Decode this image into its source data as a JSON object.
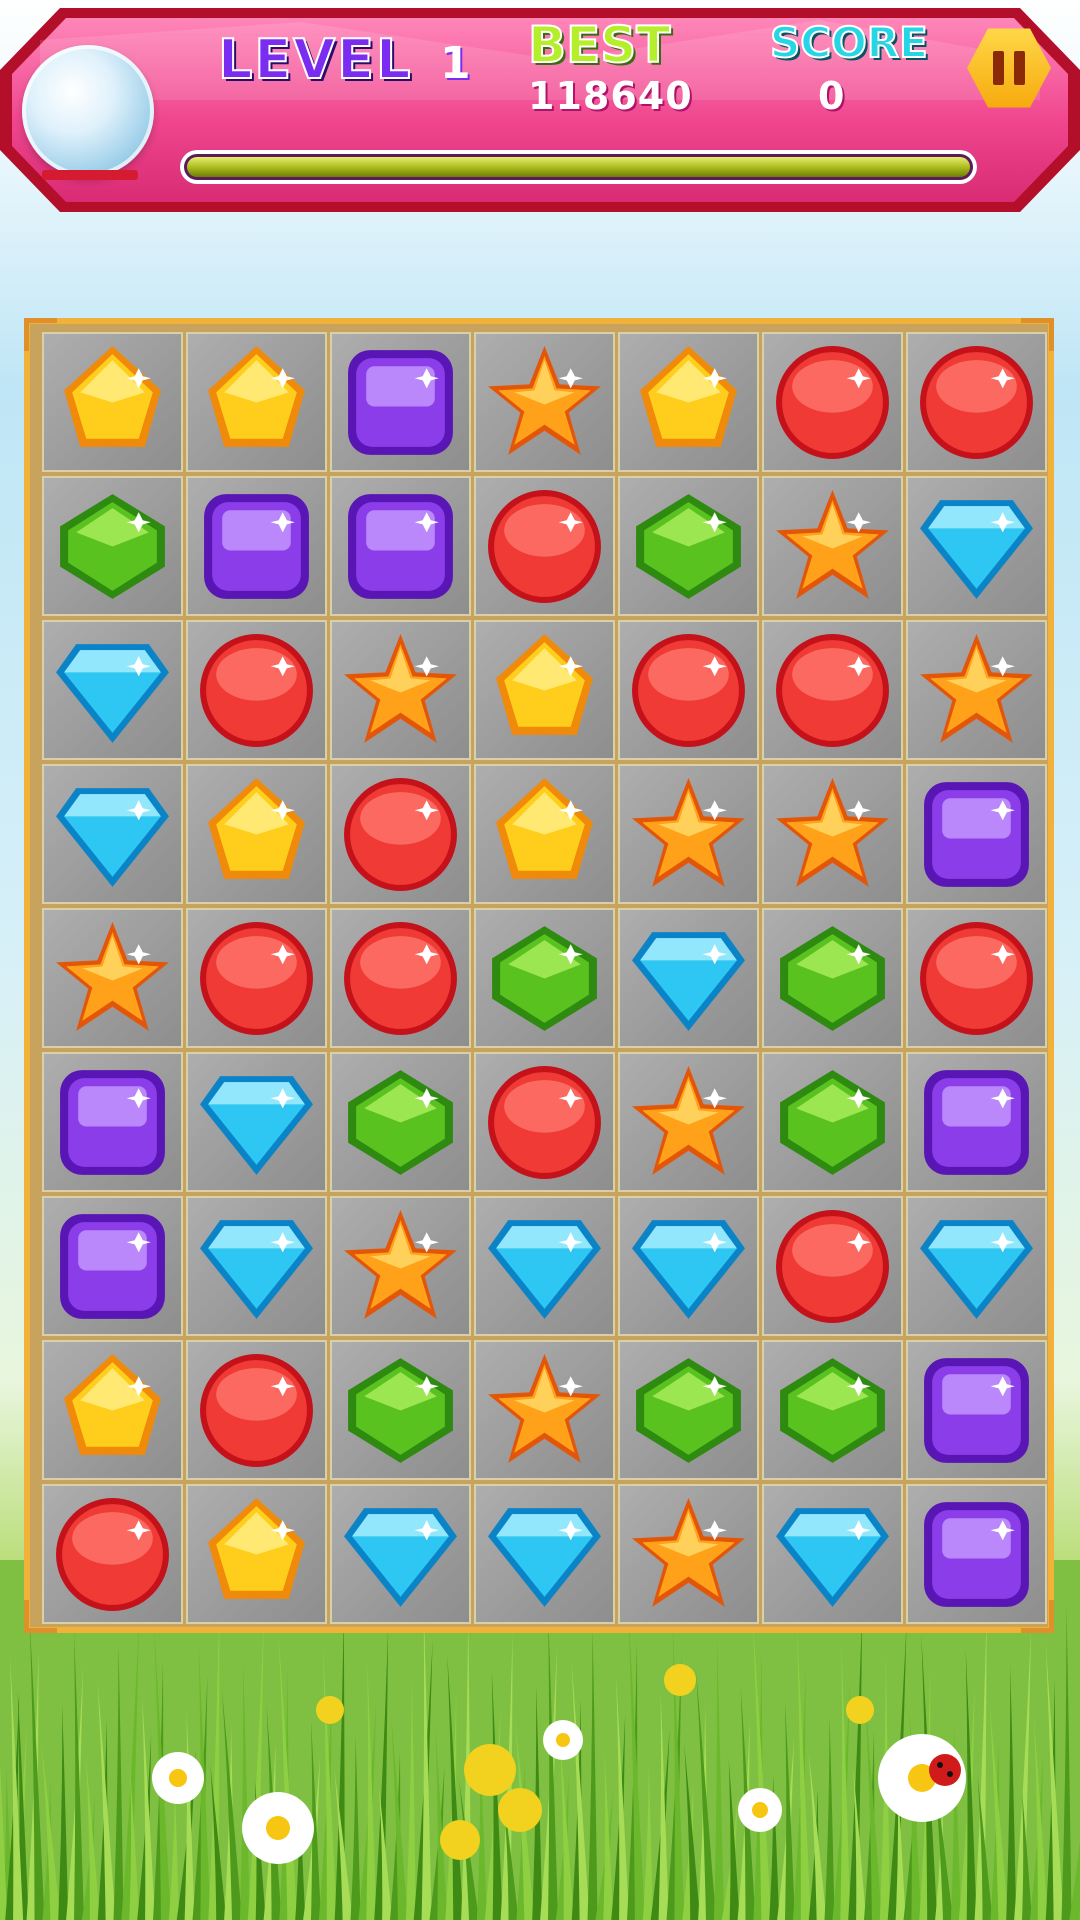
{
  "header": {
    "level_label": "LEVEL",
    "level_value": "1",
    "best_label": "BEST",
    "best_value": "118640",
    "score_label": "SCORE",
    "score_value": "0",
    "progress_fraction": 1.0,
    "pause_icon": "pause-icon",
    "orb_icon": "snow-globe-icon"
  },
  "colors": {
    "header_pink": "#f0478f",
    "header_border": "#c4102e",
    "board_border": "#f2b23a",
    "tile_gray": "#9f9f9f"
  },
  "board": {
    "rows": 9,
    "cols": 7,
    "gems": [
      [
        "yellow",
        "yellow",
        "purple",
        "orange-star",
        "yellow",
        "red",
        "red"
      ],
      [
        "green",
        "purple",
        "purple",
        "red",
        "green",
        "orange-star",
        "blue"
      ],
      [
        "blue",
        "red",
        "orange-star",
        "yellow",
        "red",
        "red",
        "orange-star"
      ],
      [
        "blue",
        "yellow",
        "red",
        "yellow",
        "orange-star",
        "orange-star",
        "purple"
      ],
      [
        "orange-star",
        "red",
        "red",
        "green",
        "blue",
        "green",
        "red"
      ],
      [
        "purple",
        "blue",
        "green",
        "red",
        "orange-star",
        "green",
        "purple"
      ],
      [
        "purple",
        "blue",
        "orange-star",
        "blue",
        "blue",
        "red",
        "blue"
      ],
      [
        "yellow",
        "red",
        "green",
        "orange-star",
        "green",
        "green",
        "purple"
      ],
      [
        "red",
        "yellow",
        "blue",
        "blue",
        "orange-star",
        "blue",
        "purple"
      ]
    ]
  }
}
